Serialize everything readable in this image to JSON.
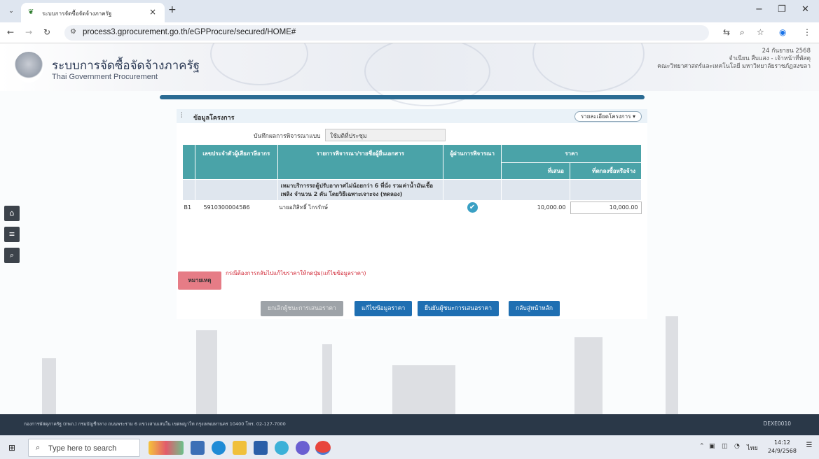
{
  "browser": {
    "tab_title": "ระบบการจัดซื้อจัดจ้างภาครัฐ",
    "tab_close": "×",
    "new_tab": "+",
    "url": "process3.gprocurement.go.th/eGPProcure/secured/HOME#",
    "window_controls": {
      "minimize": "−",
      "restore": "❐",
      "close": "✕"
    }
  },
  "header": {
    "title_th": "ระบบการจัดซื้อจัดจ้างภาครัฐ",
    "title_en": "Thai Government Procurement",
    "date": "24 กันยายน 2568",
    "user": "จำเนียน สืบแสง - เจ้าหน้าที่พัสดุ",
    "org": "คณะวิทยาศาสตร์และเทคโนโลยี มหาวิทยาลัยราชภัฏสงขลา"
  },
  "panel": {
    "title": "ข้อมูลโครงการ",
    "detail_button": "รายละเอียดโครงการ ▾",
    "record_label": "บันทึกผลการพิจารณาแบบ",
    "record_value": "ใช้มติที่ประชุม"
  },
  "table": {
    "headers": {
      "tax_id": "เลขประจำตัวผู้เสียภาษีอากร",
      "item": "รายการพิจารณา/รายชื่อผู้ยื่นเอกสาร",
      "passed": "ผู้ผ่านการพิจารณา",
      "price": "ราคา",
      "offered": "ที่เสนอ",
      "agreed": "ที่ตกลงซื้อหรือจ้าง"
    },
    "group_text": "เหมาบริการรถตู้ปรับอากาศไม่น้อยกว่า 6 ที่นั่ง รวมค่าน้ำมันเชื้อเพลิง จำนวน 2 คัน โดยวิธีเฉพาะเจาะจง (ทดลอง)",
    "rows": [
      {
        "code": "B1",
        "tax_id": "5910300004586",
        "name": "นายอภิสิทธิ์ ไกรรักษ์",
        "offered": "10,000.00",
        "agreed": "10,000.00"
      }
    ]
  },
  "note": {
    "badge": "หมายเหตุ",
    "text": "กรณีต้องการกลับไปแก้ไขราคาให้กดปุ่ม(แก้ไขข้อมูลราคา)"
  },
  "buttons": {
    "cancel_winner": "ยกเลิกผู้ชนะการเสนอราคา",
    "edit_price": "แก้ไขข้อมูลราคา",
    "confirm_winner": "ยืนยันผู้ชนะการเสนอราคา",
    "back_home": "กลับสู่หน้าหลัก"
  },
  "footer": {
    "address": "กองการพัสดุภาครัฐ (กพภ.) กรมบัญชีกลาง ถนนพระราม 6 แขวงสามเสนใน เขตพญาไท กรุงเทพมหานคร 10400 โทร. 02-127-7000",
    "page_code": "DEXE0010"
  },
  "taskbar": {
    "search_placeholder": "Type here to search",
    "lang": "ไทย",
    "time": "14:12",
    "date": "24/9/2568"
  }
}
